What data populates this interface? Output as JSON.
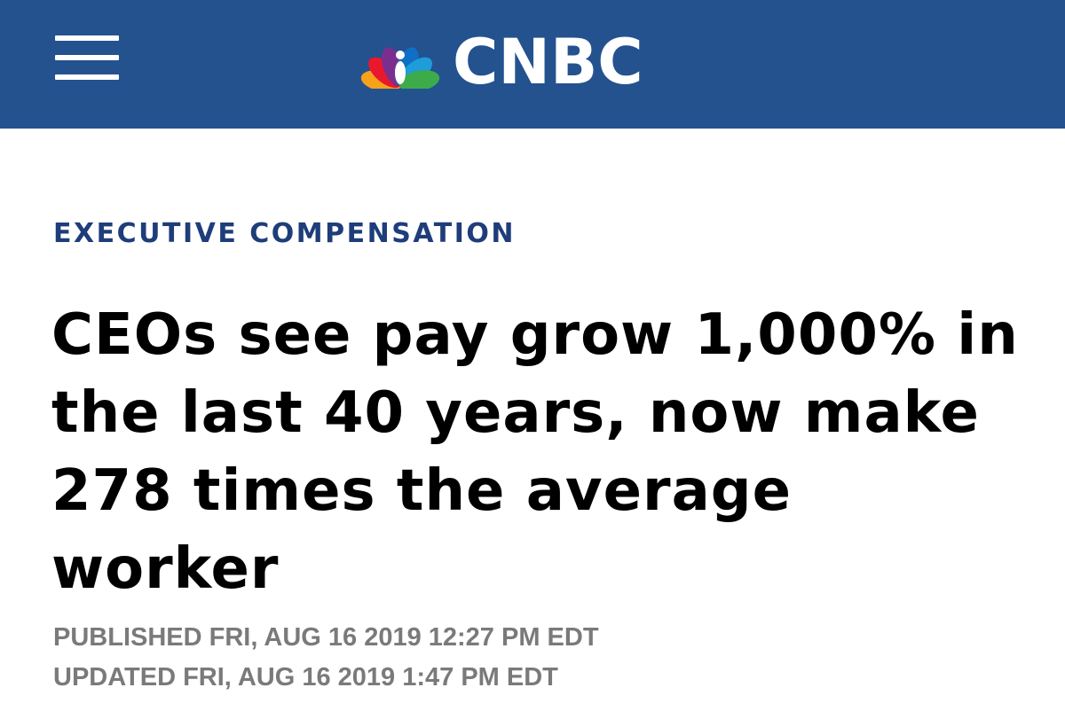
{
  "header": {
    "brand": "CNBC",
    "menu_icon": "hamburger-menu-icon",
    "logo_icon": "nbc-peacock-icon",
    "background_color": "#24528f"
  },
  "article": {
    "kicker": "EXECUTIVE COMPENSATION",
    "headline": "CEOs see pay grow 1,000% in the last 40 years, now make 278 times the average worker",
    "published": "PUBLISHED FRI, AUG 16 2019 12:27 PM EDT",
    "updated": "UPDATED FRI, AUG 16 2019 1:47 PM EDT"
  },
  "colors": {
    "kicker": "#1e3d7a",
    "headline": "#000000",
    "meta": "#7a7a7a"
  }
}
